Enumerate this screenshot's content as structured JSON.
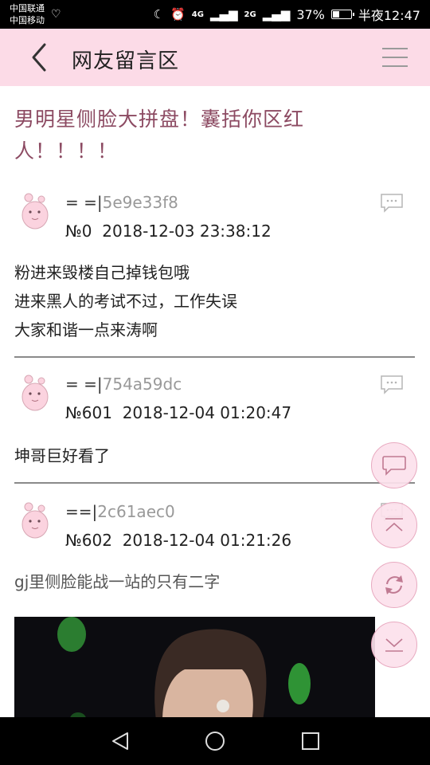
{
  "status": {
    "carrier1": "中国联通",
    "carrier2": "中国移动",
    "network1": "4G",
    "network2": "2G",
    "battery": "37%",
    "time": "半夜12:47"
  },
  "header": {
    "title": "网友留言区"
  },
  "post": {
    "title": "男明星侧脸大拼盘！囊括你区红人！！！！"
  },
  "comments": [
    {
      "user_prefix": "= =|",
      "user_hash": "5e9e33f8",
      "number": "№0",
      "time": "2018-12-03 23:38:12",
      "lines": [
        "粉进来毁楼自己掉钱包哦",
        "进来黑人的考试不过，工作失误",
        "大家和谐一点来涛啊"
      ]
    },
    {
      "user_prefix": "= =|",
      "user_hash": "754a59dc",
      "number": "№601",
      "time": "2018-12-04 01:20:47",
      "lines": [
        "坤哥巨好看了"
      ]
    },
    {
      "user_prefix": "==|",
      "user_hash": "2c61aec0",
      "number": "№602",
      "time": "2018-12-04 01:21:26",
      "lines": [
        "gj里侧脸能战一站的只有二字"
      ]
    }
  ],
  "colors": {
    "header_bg": "#fcdbe7",
    "title_color": "#8c4a62",
    "fab_border": "#e8aac0"
  },
  "icons": {
    "back": "chevron-left-icon",
    "menu": "hamburger-icon",
    "reply": "comment-bubble-icon",
    "fab_comment": "chat-icon",
    "fab_top": "scroll-top-icon",
    "fab_refresh": "refresh-icon",
    "fab_bottom": "scroll-bottom-icon"
  }
}
